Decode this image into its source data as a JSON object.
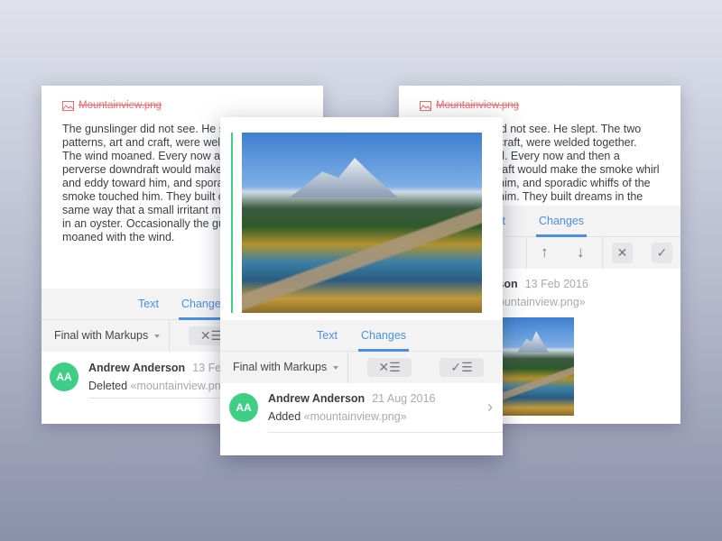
{
  "file_name": "Mountainview.png",
  "body_text": {
    "left": [
      "The gunslinger did not see. He s",
      "patterns, art and craft, were wel",
      "The wind moaned. Every now ar",
      "perverse downdraft would make",
      "and eddy toward him, and spora",
      "smoke touched him. They built c",
      "same way that a small irritant m",
      "in an oyster. Occasionally the gu",
      "moaned with the wind."
    ],
    "right": [
      "id not see. He slept. The two",
      "craft, were welded together.",
      "d. Every now and then a",
      "raft would make the smoke whirl",
      "him, and sporadic whiffs of the",
      "him. They built dreams in the"
    ]
  },
  "tabs": {
    "text": "Text",
    "changes": "Changes"
  },
  "dropdown": "Final with Markups",
  "icons": {
    "reject_all": "✕☰",
    "accept_all": "✓☰",
    "up": "↑",
    "down": "↓",
    "reject": "✕",
    "accept": "✓",
    "chevron": "›"
  },
  "left_entry": {
    "initials": "AA",
    "author": "Andrew Anderson",
    "date": "13 Feb",
    "action": "Deleted",
    "target": "«mountainview.pn"
  },
  "middle_entry": {
    "initials": "AA",
    "author": "Andrew Anderson",
    "date": "21 Aug 2016",
    "action": "Added",
    "target": "«mountainview.png»"
  },
  "right_entry": {
    "author": "derson",
    "date": "13 Feb 2016",
    "target": "ountainview.png»"
  },
  "colors": {
    "accent": "#4a90e2",
    "added": "#3ccf85",
    "deleted": "#f26a6a"
  }
}
